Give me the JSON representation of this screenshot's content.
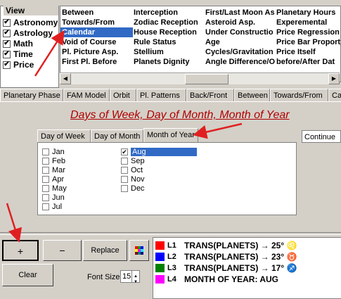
{
  "view": {
    "title": "View",
    "items": [
      {
        "label": "Astronomy",
        "checked": true
      },
      {
        "label": "Astrology",
        "checked": true
      },
      {
        "label": "Math",
        "checked": true
      },
      {
        "label": "Time",
        "checked": true
      },
      {
        "label": "Price",
        "checked": true
      }
    ]
  },
  "categories": {
    "col1": [
      "Between",
      "Towards/From",
      "Calendar",
      "Void of Course",
      "Pl. Picture Asp.",
      "First Pl. Before"
    ],
    "col2": [
      "Interception",
      "Zodiac Reception",
      "House Reception",
      "Rule Status",
      "Stellium",
      "Planets Dignity"
    ],
    "col3": [
      "First/Last Moon As",
      "Asteroid Asp.",
      "Under Constructio",
      "Age",
      "Cycles/Gravitation",
      "Angle Difference/O"
    ],
    "col4": [
      "Planetary Hours",
      "Experemental",
      "Price Regression",
      "Price Bar Proport",
      "Price Itself",
      "before/After Dat"
    ],
    "selected": "Calendar"
  },
  "main_tabs": [
    "Planetary Phase",
    "FAM Model",
    "Orbit",
    "Pl. Patterns",
    "Back/Front",
    "Between",
    "Towards/From",
    "Ca"
  ],
  "page_title": "Days of Week, Day of Month, Month of Year",
  "sub_tabs": [
    "Day of Week",
    "Day of Month",
    "Month of Year"
  ],
  "active_sub_tab": "Month of Year",
  "months": [
    {
      "label": "Jan",
      "checked": false
    },
    {
      "label": "Feb",
      "checked": false
    },
    {
      "label": "Mar",
      "checked": false
    },
    {
      "label": "Apr",
      "checked": false
    },
    {
      "label": "May",
      "checked": false
    },
    {
      "label": "Jun",
      "checked": false
    },
    {
      "label": "Jul",
      "checked": false
    },
    {
      "label": "Aug",
      "checked": true
    },
    {
      "label": "Sep",
      "checked": false
    },
    {
      "label": "Oct",
      "checked": false
    },
    {
      "label": "Nov",
      "checked": false
    },
    {
      "label": "Dec",
      "checked": false
    }
  ],
  "continue_select": {
    "value": "Continue"
  },
  "buttons": {
    "add": "+",
    "remove": "−",
    "replace": "Replace",
    "clear": "Clear"
  },
  "font_size": {
    "label": "Font Size",
    "value": "15"
  },
  "formulas": [
    {
      "id": "L1",
      "text": "TRANS(PLANETS) → 25° ♌",
      "color": "#ff0000"
    },
    {
      "id": "L2",
      "text": "TRANS(PLANETS) → 23° ♉",
      "color": "#0000ff"
    },
    {
      "id": "L3",
      "text": "TRANS(PLANETS) → 17° ♐",
      "color": "#008000"
    },
    {
      "id": "L4",
      "text": "MONTH OF YEAR:  AUG",
      "color": "#ff00ff"
    }
  ],
  "colors": {
    "selection": "#316ac5",
    "title": "#b00000",
    "annotation_arrow": "#e02020"
  }
}
